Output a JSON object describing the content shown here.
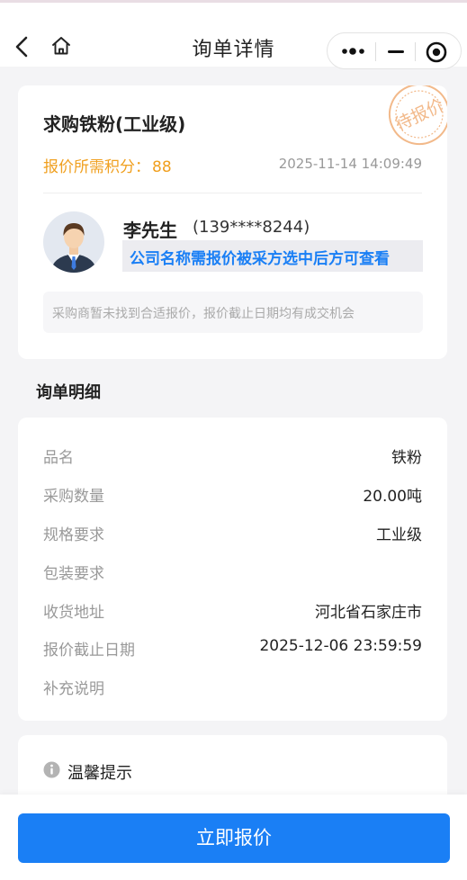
{
  "nav": {
    "title": "询单详情",
    "icons": [
      "chevron-left-icon",
      "home-icon",
      "more-dots-icon",
      "minimize-icon",
      "close-target-icon"
    ]
  },
  "inquiry": {
    "title": "求购铁粉(工业级)",
    "points_label": "报价所需积分：",
    "points_value": "88",
    "time": "2025-11-14 14:09:49",
    "stamp_text": "待报价",
    "buyer_name": "李先生",
    "buyer_phone": "(139****8244)",
    "company_hint": "公司名称需报价被采方选中后方可查看",
    "notice": "采购商暂未找到合适报价，报价截止日期均有成交机会"
  },
  "detail": {
    "section_title": "询单明细",
    "rows": [
      {
        "label": "品名",
        "value": "铁粉"
      },
      {
        "label": "采购数量",
        "value": "20.00吨"
      },
      {
        "label": "规格要求",
        "value": "工业级"
      },
      {
        "label": "包装要求",
        "value": ""
      },
      {
        "label": "收货地址",
        "value": "河北省石家庄市"
      },
      {
        "label": "报价截止日期",
        "value": "2025-12-06 23:59:59"
      },
      {
        "label": "补充说明",
        "value": ""
      }
    ]
  },
  "tips": {
    "title": "温馨提示"
  },
  "footer": {
    "quote_button": "立即报价"
  },
  "colors": {
    "accent": "#1a7ff5",
    "points": "#f0a020",
    "stamp": "#f2b98a"
  }
}
